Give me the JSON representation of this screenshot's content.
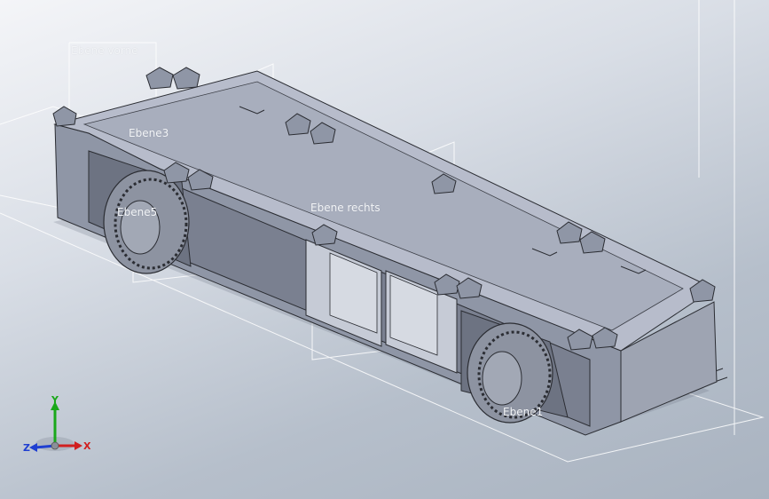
{
  "plane_labels": {
    "front": "Ebene vorne",
    "plane3": "Ebene3",
    "plane5": "Ebene5",
    "right": "Ebene rechts",
    "plane1": "Ebene1"
  },
  "triad": {
    "x": "X",
    "y": "Y",
    "z": "Z"
  },
  "colors": {
    "body": "#8f96a6",
    "top": "#b7bccb",
    "shadow": "#6d7382",
    "edge": "#2b2d33",
    "x_axis": "#d11f1f",
    "y_axis": "#1aa81a",
    "z_axis": "#1f3fd1"
  }
}
